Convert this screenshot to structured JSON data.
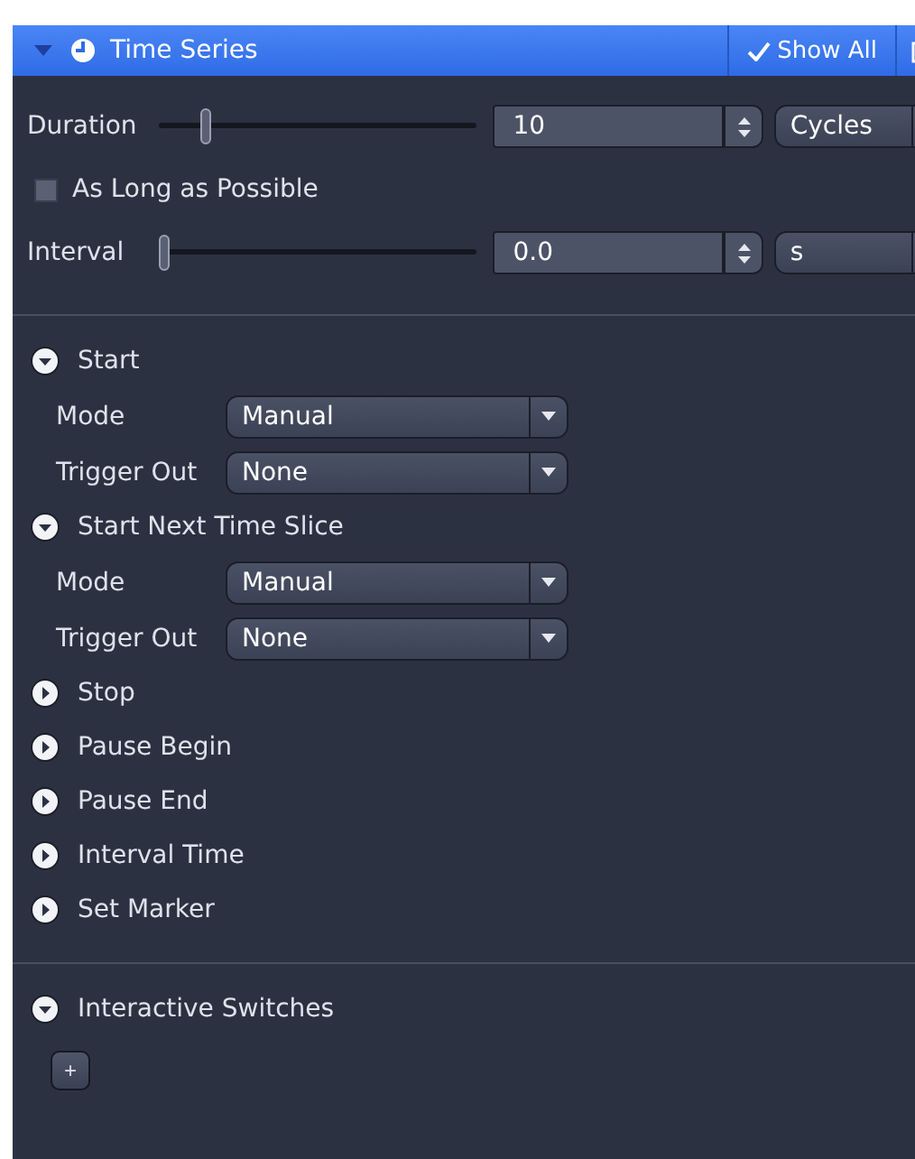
{
  "header": {
    "title": "Time Series",
    "expanded": true,
    "show_all": {
      "label": "Show All",
      "checked": true
    }
  },
  "settings": [
    {
      "kind": "slider",
      "label": "Duration",
      "level": 0.15,
      "value": "10",
      "unit": "Cycles"
    },
    {
      "kind": "checkbox",
      "label": "As Long as Possible",
      "checked": false
    },
    {
      "kind": "slider",
      "label": "Interval",
      "level": 0.0,
      "value": "0.0",
      "unit": "s"
    }
  ],
  "sections": [
    {
      "title": "Start",
      "expanded": true,
      "fields": [
        {
          "label": "Mode",
          "value": "Manual"
        },
        {
          "label": "Trigger Out",
          "value": "None"
        }
      ]
    },
    {
      "title": "Start Next Time Slice",
      "expanded": true,
      "fields": [
        {
          "label": "Mode",
          "value": "Manual"
        },
        {
          "label": "Trigger Out",
          "value": "None"
        }
      ]
    },
    {
      "title": "Stop",
      "expanded": false
    },
    {
      "title": "Pause Begin",
      "expanded": false
    },
    {
      "title": "Pause End",
      "expanded": false
    },
    {
      "title": "Interval Time",
      "expanded": false
    },
    {
      "title": "Set Marker",
      "expanded": false
    }
  ],
  "interactive": {
    "title": "Interactive Switches",
    "expanded": true,
    "add_button": "+"
  }
}
